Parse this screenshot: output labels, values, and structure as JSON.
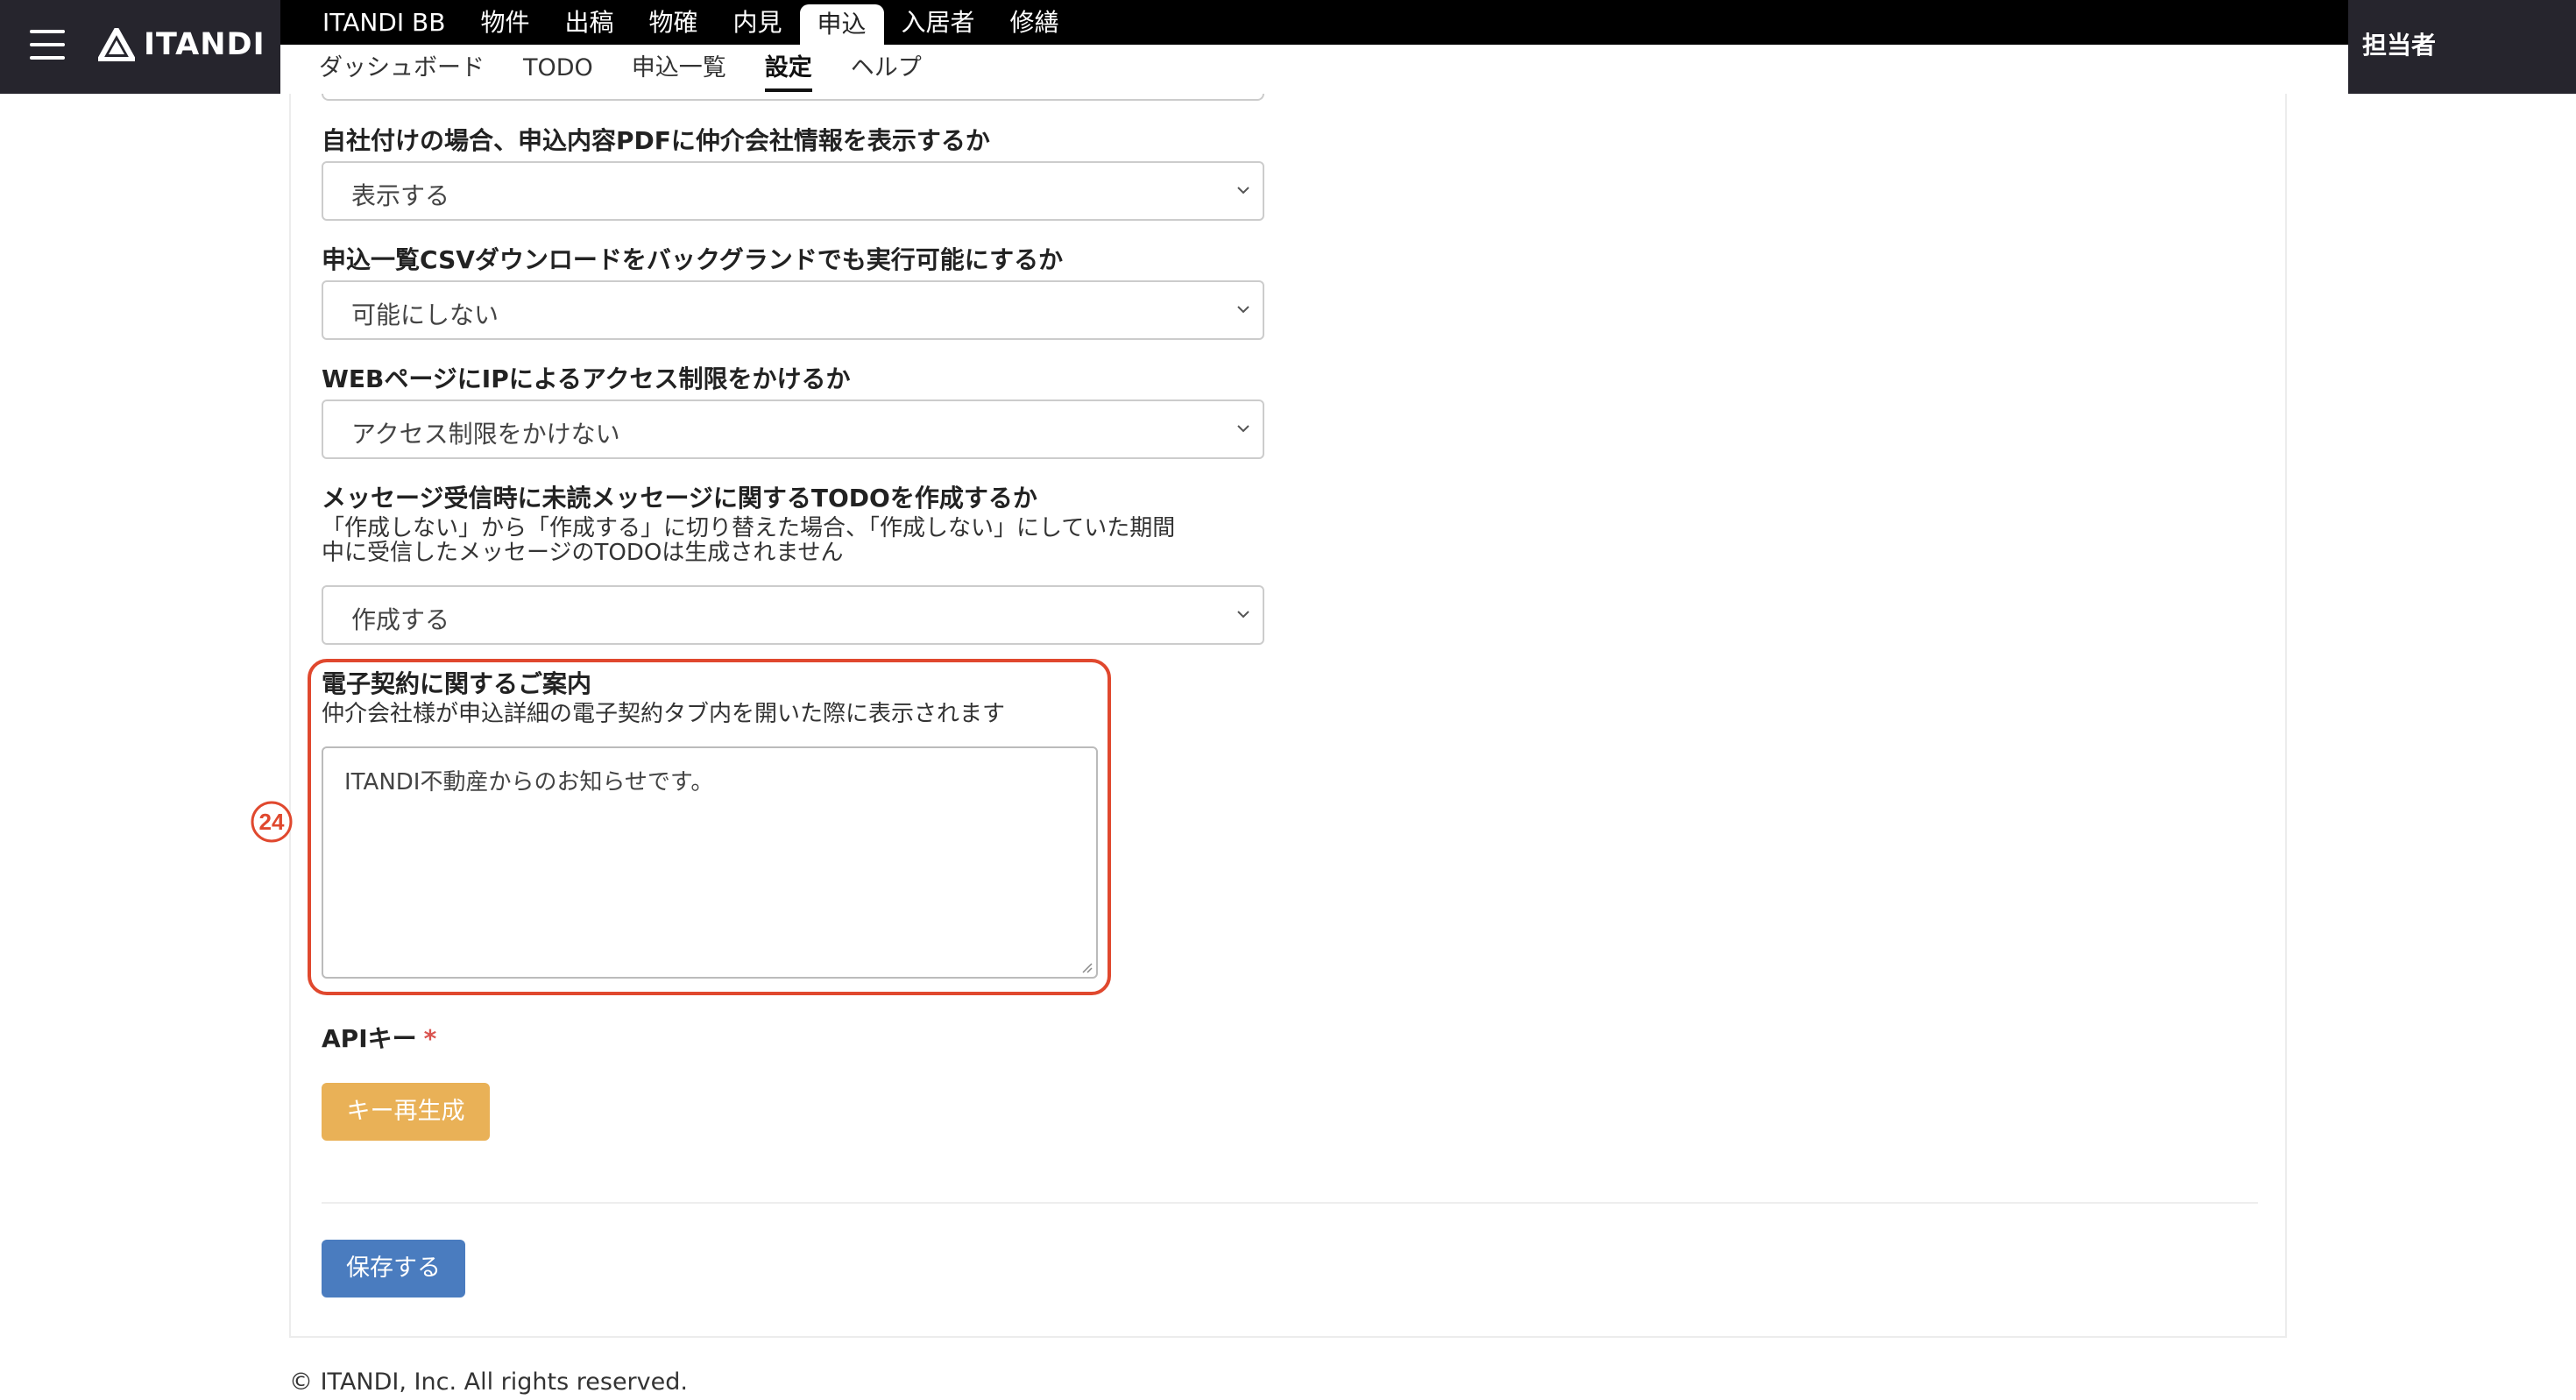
{
  "header": {
    "logo_text": "ITANDI",
    "primary_tabs": [
      "ITANDI BB",
      "物件",
      "出稿",
      "物確",
      "内見",
      "申込",
      "入居者",
      "修繕"
    ],
    "active_primary": "申込",
    "secondary_tabs": [
      "ダッシュボード",
      "TODO",
      "申込一覧",
      "設定",
      "ヘルプ"
    ],
    "active_secondary": "設定",
    "user_label": "担当者"
  },
  "form": {
    "pdf_broker": {
      "label": "自社付けの場合、申込内容PDFに仲介会社情報を表示するか",
      "value": "表示する"
    },
    "csv_background": {
      "label": "申込一覧CSVダウンロードをバックグランドでも実行可能にするか",
      "value": "可能にしない"
    },
    "ip_restriction": {
      "label": "WEBページにIPによるアクセス制限をかけるか",
      "value": "アクセス制限をかけない"
    },
    "unread_todo": {
      "label": "メッセージ受信時に未読メッセージに関するTODOを作成するか",
      "help_line1": "「作成しない」から「作成する」に切り替えた場合、「作成しない」にしていた期間",
      "help_line2": "中に受信したメッセージのTODOは生成されません",
      "value": "作成する"
    },
    "e_contract": {
      "label": "電子契約に関するご案内",
      "help": "仲介会社様が申込詳細の電子契約タブ内を開いた際に表示されます",
      "value": "ITANDI不動産からのお知らせです。"
    },
    "api_key": {
      "label": "APIキー",
      "required_mark": "*"
    },
    "regenerate_button": "キー再生成",
    "save_button": "保存する"
  },
  "annotation": {
    "number": "㉔",
    "color": "#e0482e"
  },
  "footer": {
    "copyright": "© ITANDI, Inc. All rights reserved."
  }
}
